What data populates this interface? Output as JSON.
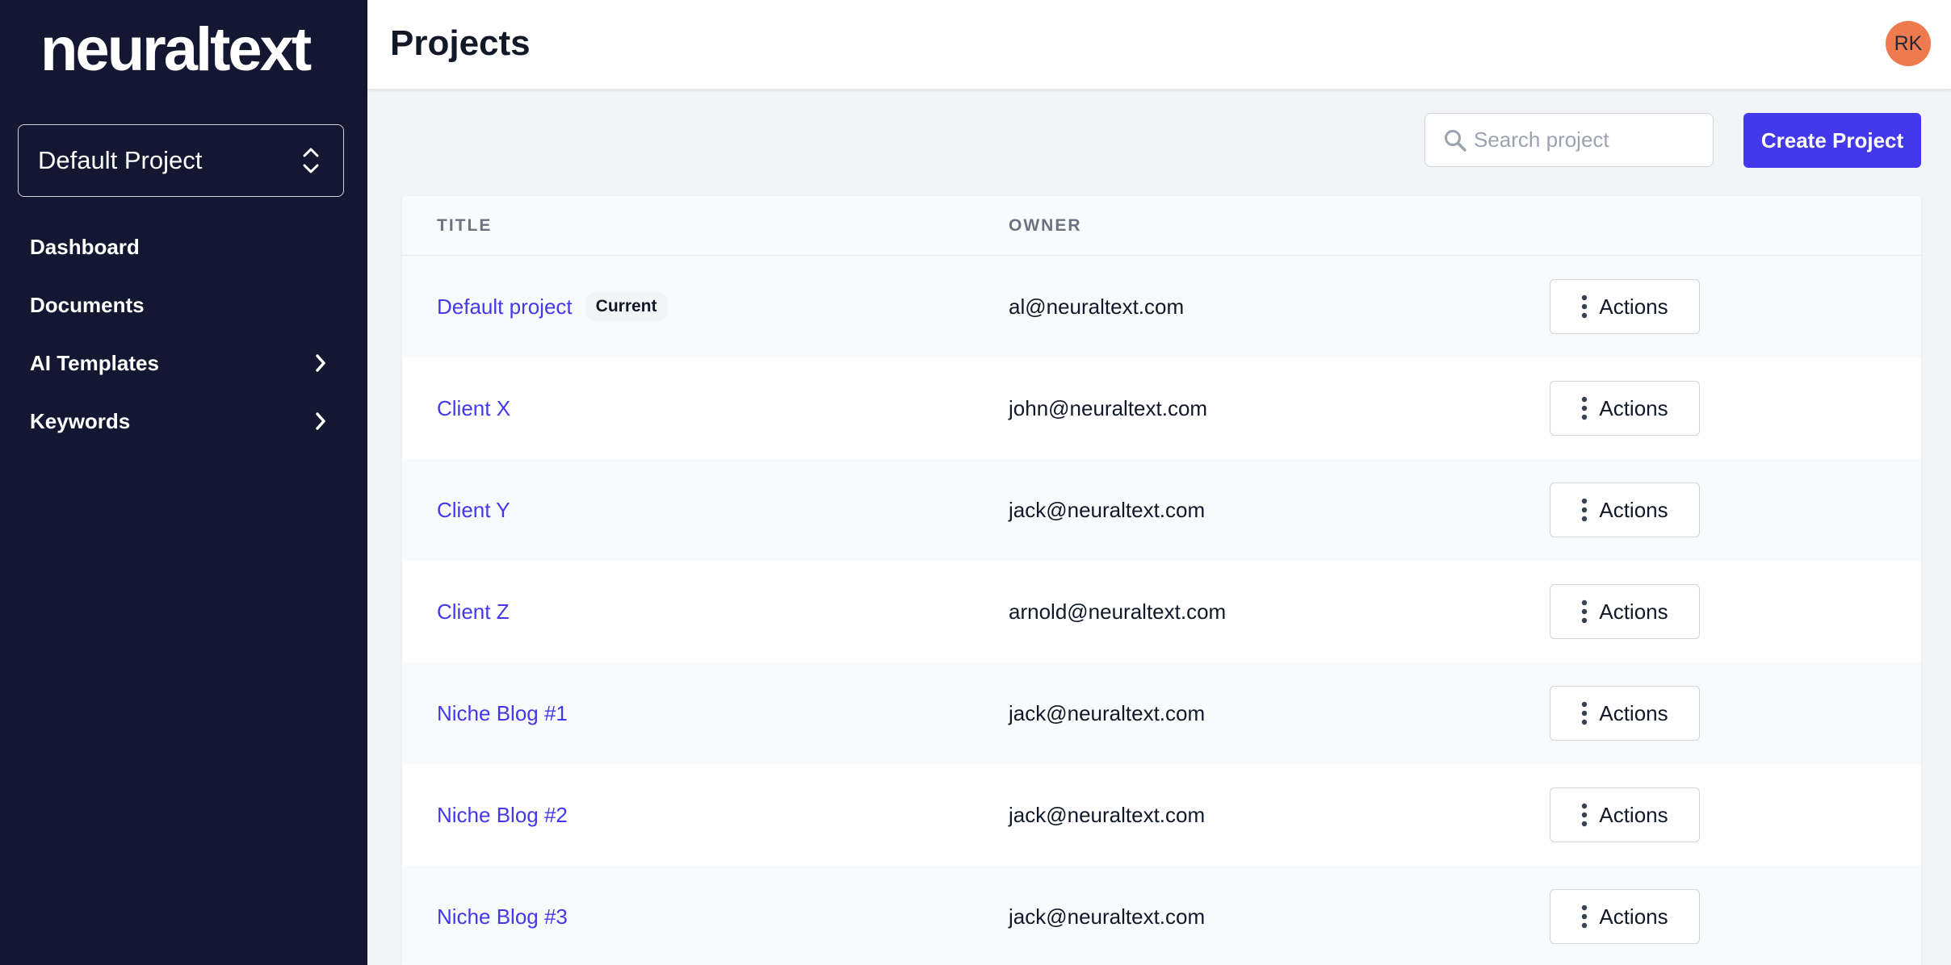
{
  "sidebar": {
    "logo": "neuraltext",
    "project_selector": "Default Project",
    "items": [
      {
        "label": "Dashboard",
        "has_chevron": false
      },
      {
        "label": "Documents",
        "has_chevron": false
      },
      {
        "label": "AI Templates",
        "has_chevron": true
      },
      {
        "label": "Keywords",
        "has_chevron": true
      }
    ]
  },
  "header": {
    "title": "Projects",
    "avatar_initials": "RK"
  },
  "toolbar": {
    "search_placeholder": "Search project",
    "search_value": "",
    "create_label": "Create Project"
  },
  "table": {
    "columns": [
      "TITLE",
      "OWNER"
    ],
    "action_label": "Actions",
    "rows": [
      {
        "title": "Default project",
        "badge": "Current",
        "owner": "al@neuraltext.com"
      },
      {
        "title": "Client X",
        "badge": "",
        "owner": "john@neuraltext.com"
      },
      {
        "title": "Client Y",
        "badge": "",
        "owner": "jack@neuraltext.com"
      },
      {
        "title": "Client Z",
        "badge": "",
        "owner": "arnold@neuraltext.com"
      },
      {
        "title": "Niche Blog #1",
        "badge": "",
        "owner": "jack@neuraltext.com"
      },
      {
        "title": "Niche Blog #2",
        "badge": "",
        "owner": "jack@neuraltext.com"
      },
      {
        "title": "Niche Blog #3",
        "badge": "",
        "owner": "jack@neuraltext.com"
      }
    ]
  },
  "colors": {
    "sidebar_bg": "#141731",
    "accent": "#4338ea",
    "avatar_bg": "#ee7a4f"
  },
  "icons": [
    "updown-icon",
    "chevron-right-icon",
    "search-icon",
    "kebab-icon"
  ]
}
